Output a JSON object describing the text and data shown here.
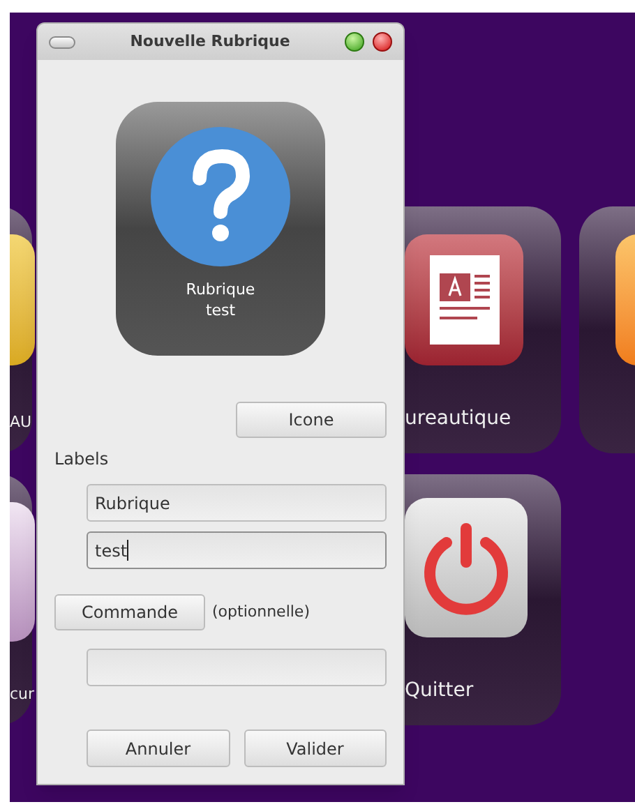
{
  "window": {
    "title": "Nouvelle Rubrique"
  },
  "preview": {
    "lines": [
      "Rubrique",
      "test"
    ]
  },
  "icon_button": "Icone",
  "labels_heading": "Labels",
  "label_fields": [
    {
      "value": "Rubrique",
      "focused": false
    },
    {
      "value": "test",
      "focused": true
    }
  ],
  "command": {
    "button": "Commande",
    "hint": "(optionnelle)"
  },
  "buttons": [
    "Annuler",
    "Valider"
  ],
  "desktop_tiles": [
    {
      "kind": "yellow",
      "label": "AU"
    },
    {
      "kind": "document",
      "label": "ureautique"
    },
    {
      "kind": "orange"
    },
    {
      "kind": "lavender",
      "label": "cur"
    },
    {
      "kind": "power",
      "label": "Quitter"
    }
  ]
}
